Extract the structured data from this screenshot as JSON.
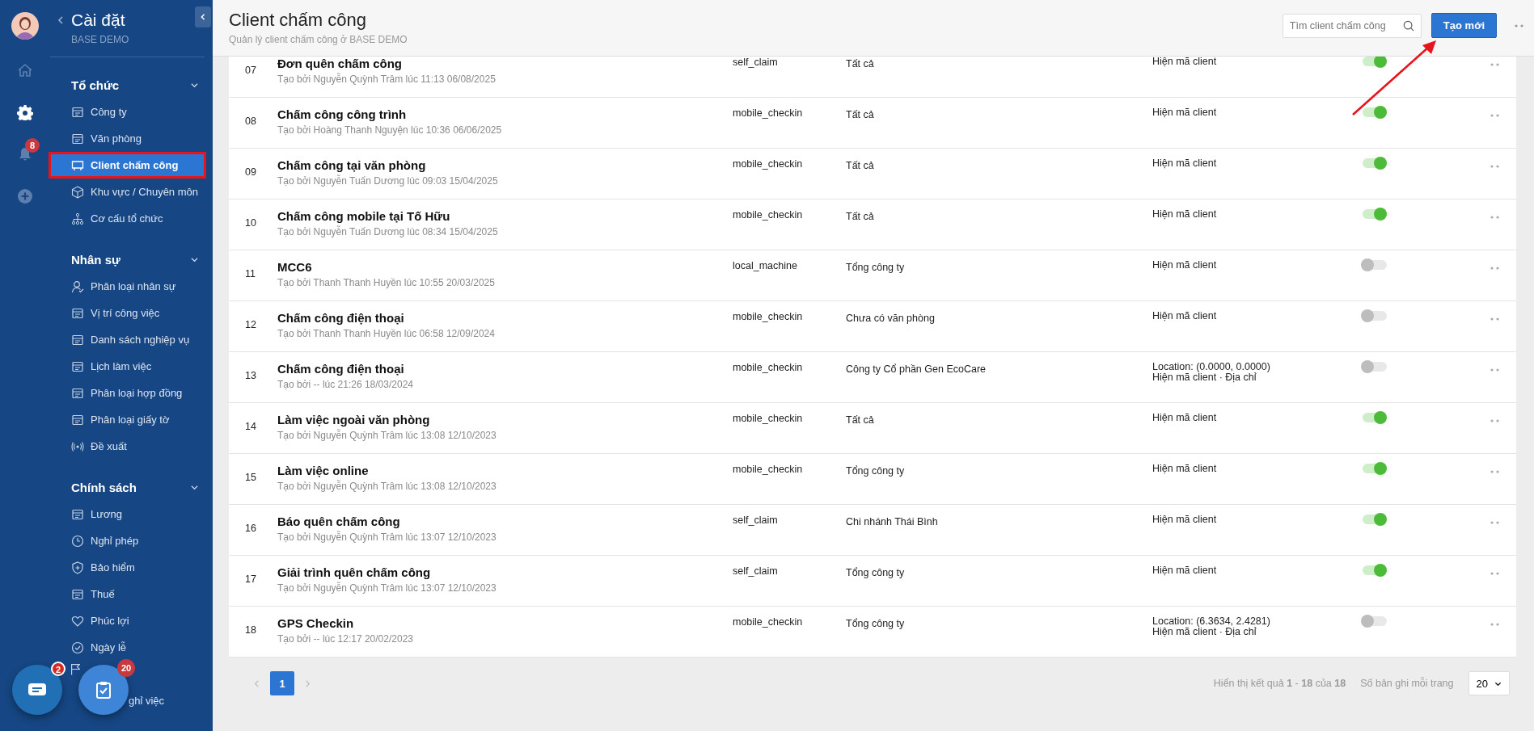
{
  "sidebar": {
    "title": "Cài đặt",
    "subtitle": "BASE DEMO",
    "notification_count": "8",
    "sections": [
      {
        "title": "Tổ chức",
        "expanded": true,
        "items": [
          {
            "label": "Công ty",
            "selected": false
          },
          {
            "label": "Văn phòng",
            "selected": false
          },
          {
            "label": "Client chấm công",
            "selected": true
          },
          {
            "label": "Khu vực / Chuyên môn",
            "selected": false
          },
          {
            "label": "Cơ cấu tổ chức",
            "selected": false
          }
        ]
      },
      {
        "title": "Nhân sự",
        "expanded": true,
        "items": [
          {
            "label": "Phân loại nhân sự",
            "selected": false
          },
          {
            "label": "Vị trí công việc",
            "selected": false
          },
          {
            "label": "Danh sách nghiệp vụ",
            "selected": false
          },
          {
            "label": "Lịch làm việc",
            "selected": false
          },
          {
            "label": "Phân loại hợp đồng",
            "selected": false
          },
          {
            "label": "Phân loại giấy tờ",
            "selected": false
          },
          {
            "label": "Đề xuất",
            "selected": false
          }
        ]
      },
      {
        "title": "Chính sách",
        "expanded": true,
        "items": [
          {
            "label": "Lương",
            "selected": false
          },
          {
            "label": "Nghỉ phép",
            "selected": false
          },
          {
            "label": "Bảo hiểm",
            "selected": false
          },
          {
            "label": "Thuế",
            "selected": false
          },
          {
            "label": "Phúc lợi",
            "selected": false
          },
          {
            "label": "Ngày lễ",
            "selected": false
          },
          {
            "kind": "icon_only",
            "selected": false
          },
          {
            "kind": "covered",
            "label": "ghỉ việc",
            "selected": false
          }
        ]
      }
    ]
  },
  "floating": [
    {
      "kind": "chat",
      "badge": "2"
    },
    {
      "kind": "tasks",
      "badge": "20"
    }
  ],
  "header": {
    "title": "Client chấm công",
    "subtitle": "Quản lý client chấm công ở BASE DEMO",
    "search": {
      "placeholder": "Tìm client chấm công"
    },
    "create_button": "Tạo mới"
  },
  "rows": [
    {
      "num": "07",
      "name": "Đơn quên chấm công",
      "creator": "Tạo bởi Nguyễn Quỳnh Trâm lúc 11:13 06/08/2025",
      "type": "self_claim",
      "scope": "Tất cả",
      "display": [
        "Hiện mã client"
      ],
      "on": true
    },
    {
      "num": "08",
      "name": "Chấm công công trình",
      "creator": "Tạo bởi Hoàng Thanh Nguyện lúc 10:36 06/06/2025",
      "type": "mobile_checkin",
      "scope": "Tất cả",
      "display": [
        "Hiện mã client"
      ],
      "on": true
    },
    {
      "num": "09",
      "name": "Chấm công tại văn phòng",
      "creator": "Tạo bởi Nguyễn Tuấn Dương lúc 09:03 15/04/2025",
      "type": "mobile_checkin",
      "scope": "Tất cả",
      "display": [
        "Hiện mã client"
      ],
      "on": true
    },
    {
      "num": "10",
      "name": "Chấm công mobile tại Tố Hữu",
      "creator": "Tạo bởi Nguyễn Tuấn Dương lúc 08:34 15/04/2025",
      "type": "mobile_checkin",
      "scope": "Tất cả",
      "display": [
        "Hiện mã client"
      ],
      "on": true
    },
    {
      "num": "11",
      "name": "MCC6",
      "creator": "Tạo bởi Thanh Thanh Huyền lúc 10:55 20/03/2025",
      "type": "local_machine",
      "scope": "Tổng công ty",
      "display": [
        "Hiện mã client"
      ],
      "on": false
    },
    {
      "num": "12",
      "name": "Chấm công điện thoại",
      "creator": "Tạo bởi Thanh Thanh Huyền lúc 06:58 12/09/2024",
      "type": "mobile_checkin",
      "scope": "Chưa có văn phòng",
      "display": [
        "Hiện mã client"
      ],
      "on": false
    },
    {
      "num": "13",
      "name": "Chấm công điện thoại",
      "creator": "Tạo bởi -- lúc 21:26 18/03/2024",
      "type": "mobile_checkin",
      "scope": "Công ty Cổ phần Gen EcoCare",
      "display": [
        "Location: (0.0000, 0.0000)",
        "Hiện mã client · Địa chỉ"
      ],
      "on": false
    },
    {
      "num": "14",
      "name": "Làm việc ngoài văn phòng",
      "creator": "Tạo bởi Nguyễn Quỳnh Trâm lúc 13:08 12/10/2023",
      "type": "mobile_checkin",
      "scope": "Tất cả",
      "display": [
        "Hiện mã client"
      ],
      "on": true
    },
    {
      "num": "15",
      "name": "Làm việc online",
      "creator": "Tạo bởi Nguyễn Quỳnh Trâm lúc 13:08 12/10/2023",
      "type": "mobile_checkin",
      "scope": "Tổng công ty",
      "display": [
        "Hiện mã client"
      ],
      "on": true
    },
    {
      "num": "16",
      "name": "Báo quên chấm công",
      "creator": "Tạo bởi Nguyễn Quỳnh Trâm lúc 13:07 12/10/2023",
      "type": "self_claim",
      "scope": "Chi nhánh Thái Bình",
      "display": [
        "Hiện mã client"
      ],
      "on": true
    },
    {
      "num": "17",
      "name": "Giải trình quên chấm công",
      "creator": "Tạo bởi Nguyễn Quỳnh Trâm lúc 13:07 12/10/2023",
      "type": "self_claim",
      "scope": "Tổng công ty",
      "display": [
        "Hiện mã client"
      ],
      "on": true
    },
    {
      "num": "18",
      "name": "GPS Checkin",
      "creator": "Tạo bởi -- lúc 12:17 20/02/2023",
      "type": "mobile_checkin",
      "scope": "Tổng công ty",
      "display": [
        "Location: (6.3634, 2.4281)",
        "Hiện mã client · Địa chỉ"
      ],
      "on": false
    }
  ],
  "pagination": {
    "pages": [
      {
        "label": "1",
        "selected": true
      }
    ],
    "summary": "Hiển thị kết quả **1** - **18** của **18**",
    "page_size_label": "Số bản ghi mỗi trang",
    "page_size": "20"
  }
}
